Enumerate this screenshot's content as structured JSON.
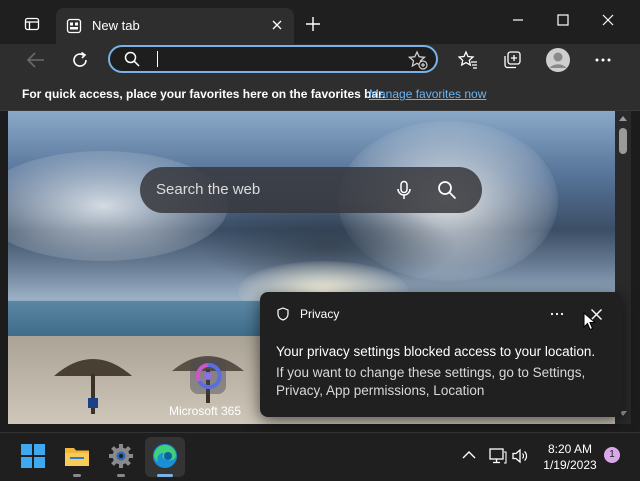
{
  "browser": {
    "tab": {
      "title": "New tab"
    },
    "address_bar": {
      "value": ""
    },
    "favorites_bar": {
      "hint": "For quick access, place your favorites here on the favorites bar.",
      "link": "Manage favorites now"
    }
  },
  "new_tab_page": {
    "search": {
      "placeholder": "Search the web"
    },
    "tile": {
      "label": "Microsoft 365"
    }
  },
  "privacy_popup": {
    "title": "Privacy",
    "message": "Your privacy settings blocked access to your location.",
    "detail": "If you want to change these settings, go to Settings, Privacy, App permissions, Location"
  },
  "taskbar": {
    "time": "8:20 AM",
    "date": "1/19/2023",
    "notification_count": "1"
  },
  "colors": {
    "accent": "#7ab1e6",
    "link": "#6cb4f0",
    "titlebar": "#1f1f1f",
    "toolbar": "#2e2e2e"
  }
}
